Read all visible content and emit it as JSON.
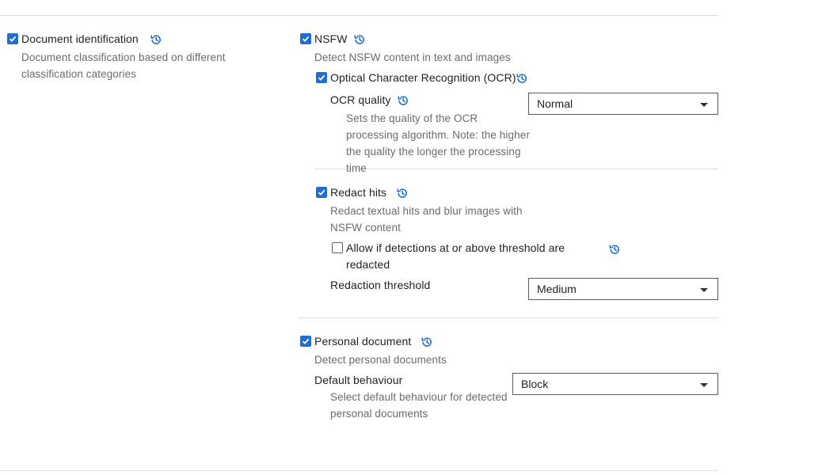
{
  "document_identification": {
    "label": "Document identification",
    "description": "Document classification based on different classification categories",
    "checked": true
  },
  "nsfw": {
    "label": "NSFW",
    "description": "Detect NSFW content in text and images",
    "checked": true,
    "ocr": {
      "label": "Optical Character Recognition (OCR)",
      "checked": true,
      "quality": {
        "label": "OCR quality",
        "description": "Sets the quality of the OCR processing algorithm. Note: the higher the quality the longer the processing time",
        "value": "Normal"
      }
    },
    "redact": {
      "label": "Redact hits",
      "description": "Redact textual hits and blur images with NSFW content",
      "checked": true,
      "allow_threshold": {
        "label": "Allow if detections at or above threshold are redacted",
        "checked": false
      },
      "threshold": {
        "label": "Redaction threshold",
        "value": "Medium"
      }
    }
  },
  "personal_document": {
    "label": "Personal document",
    "description": "Detect personal documents",
    "checked": true,
    "default_behaviour": {
      "label": "Default behaviour",
      "description": "Select default behaviour for detected personal documents",
      "value": "Block"
    }
  },
  "icons": {
    "history": "history-icon",
    "check": "checkmark-icon",
    "caret": "caret-down-icon"
  },
  "colors": {
    "accent": "#1f6fd1",
    "description_text": "#6b6b6b",
    "divider": "#dcdcdc"
  }
}
